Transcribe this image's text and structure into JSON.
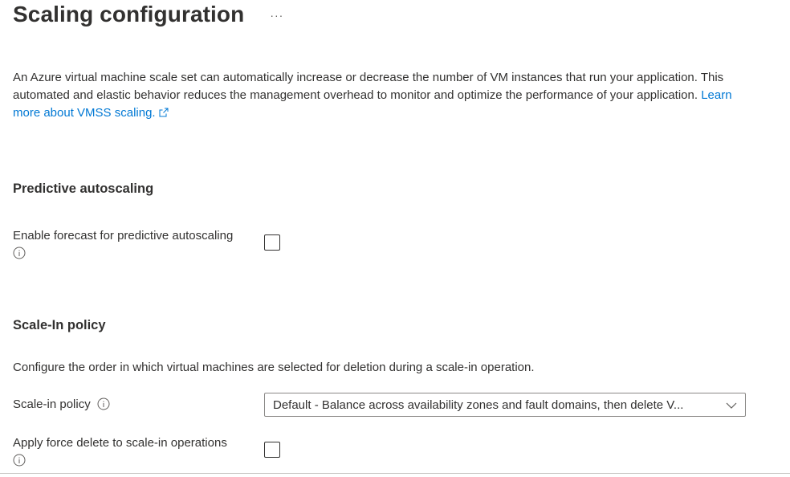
{
  "header": {
    "title": "Scaling configuration",
    "more_label": "···"
  },
  "intro": {
    "text": "An Azure virtual machine scale set can automatically increase or decrease the number of VM instances that run your application. This automated and elastic behavior reduces the management overhead to monitor and optimize the performance of your application.",
    "link_text": "Learn more about VMSS scaling.",
    "link_icon": "external-link-icon"
  },
  "predictive": {
    "heading": "Predictive autoscaling",
    "forecast_label": "Enable forecast for predictive autoscaling",
    "forecast_checked": false,
    "info_icon": "info-icon"
  },
  "scale_in": {
    "heading": "Scale-In policy",
    "description": "Configure the order in which virtual machines are selected for deletion during a scale-in operation.",
    "policy_label": "Scale-in policy",
    "policy_value": "Default - Balance across availability zones and fault domains, then delete V...",
    "force_delete_label": "Apply force delete to scale-in operations",
    "force_delete_checked": false
  },
  "colors": {
    "link": "#0078d4",
    "text": "#323130",
    "border": "#8a8886"
  }
}
